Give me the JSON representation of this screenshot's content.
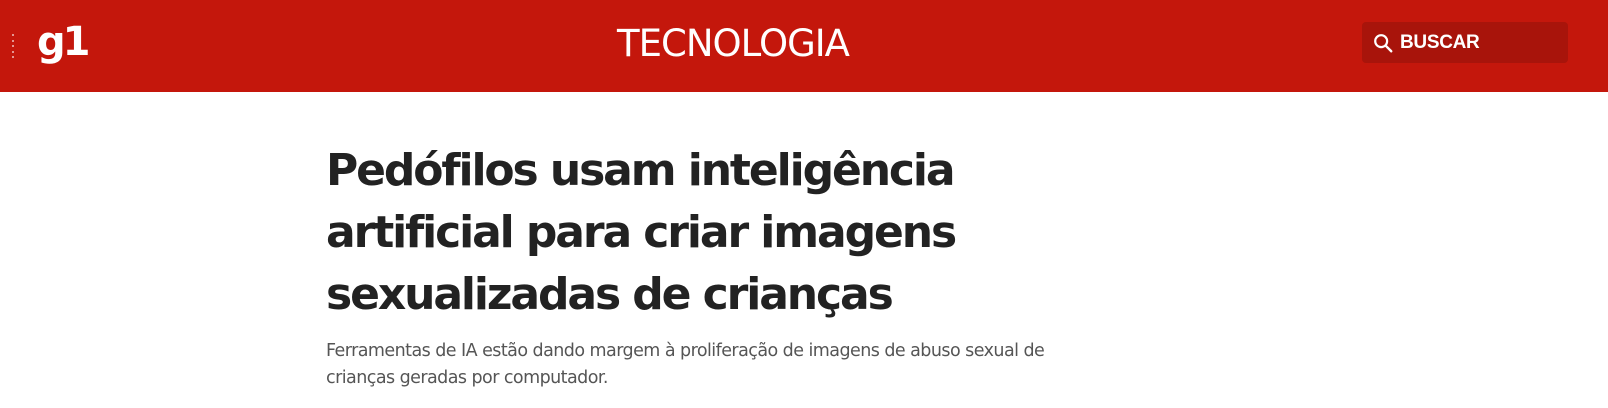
{
  "header": {
    "logo": "g1",
    "section": "TECNOLOGIA",
    "search_label": "BUSCAR",
    "bg_color": "#c4170c",
    "search_bg_color": "#a8140b",
    "icons": [
      "menu-icon",
      "search-icon"
    ]
  },
  "article": {
    "title": "Pedófilos usam inteligência artificial para criar imagens sexualizadas de crianças",
    "subtitle": "Ferramentas de IA estão dando margem à proliferação de imagens de abuso sexual de crianças geradas por computador."
  }
}
